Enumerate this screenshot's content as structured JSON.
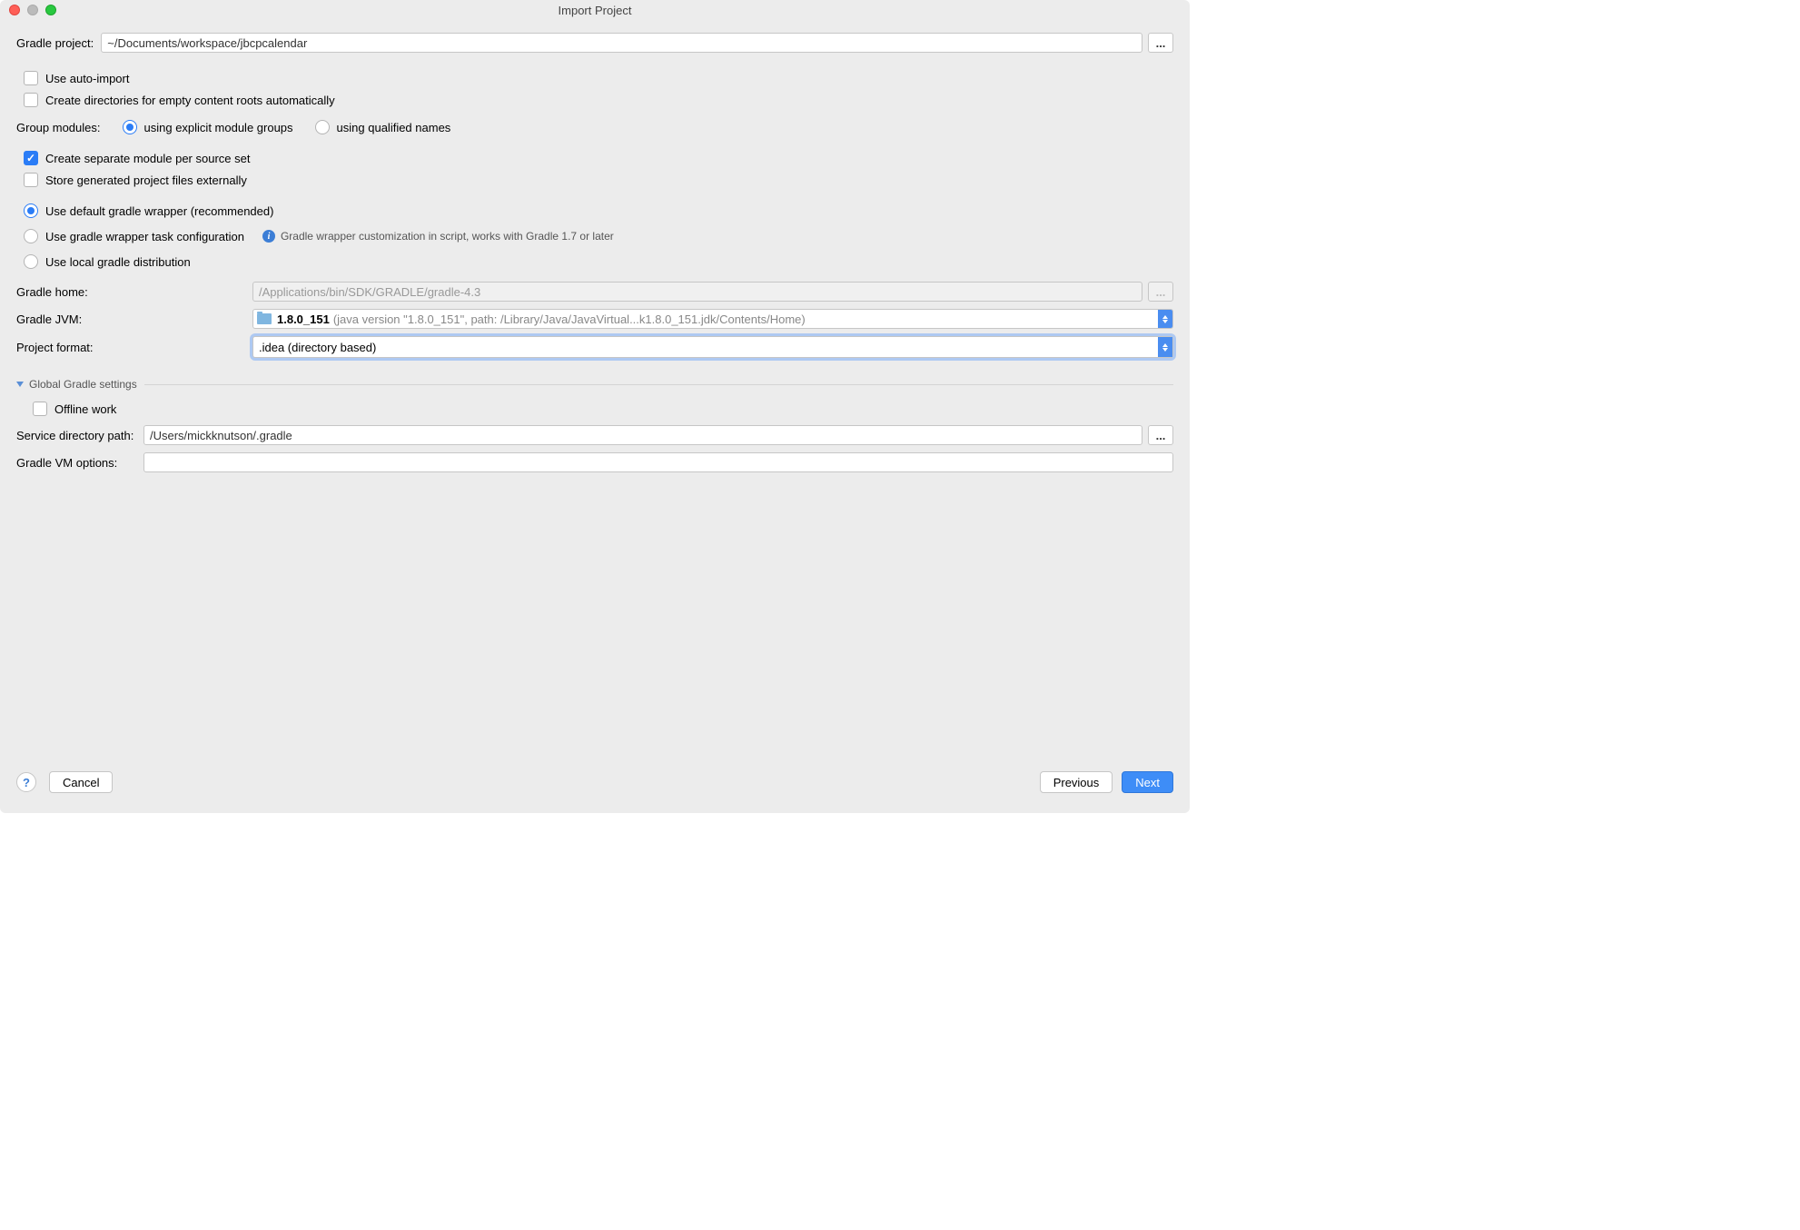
{
  "window": {
    "title": "Import Project"
  },
  "gradle_project": {
    "label": "Gradle project:",
    "path": "~/Documents/workspace/jbcpcalendar"
  },
  "options": {
    "auto_import": {
      "label": "Use auto-import",
      "checked": false
    },
    "create_dirs": {
      "label": "Create directories for empty content roots automatically",
      "checked": false
    },
    "group_modules_label": "Group modules:",
    "group_explicit": {
      "label": "using explicit module groups",
      "selected": true
    },
    "group_qualified": {
      "label": "using qualified names",
      "selected": false
    },
    "separate_module": {
      "label": "Create separate module per source set",
      "checked": true
    },
    "store_external": {
      "label": "Store generated project files externally",
      "checked": false
    }
  },
  "wrapper": {
    "default": {
      "label": "Use default gradle wrapper (recommended)",
      "selected": true
    },
    "task": {
      "label": "Use gradle wrapper task configuration",
      "hint": "Gradle wrapper customization in script, works with Gradle 1.7 or later",
      "selected": false
    },
    "local": {
      "label": "Use local gradle distribution",
      "selected": false
    }
  },
  "gradle_home": {
    "label": "Gradle home:",
    "value": "/Applications/bin/SDK/GRADLE/gradle-4.3"
  },
  "gradle_jvm": {
    "label": "Gradle JVM:",
    "version": "1.8.0_151",
    "detail": "(java version \"1.8.0_151\", path: /Library/Java/JavaVirtual...k1.8.0_151.jdk/Contents/Home)"
  },
  "project_format": {
    "label": "Project format:",
    "value": ".idea (directory based)"
  },
  "global": {
    "header": "Global Gradle settings",
    "offline": {
      "label": "Offline work",
      "checked": false
    },
    "service_dir_label": "Service directory path:",
    "service_dir": "/Users/mickknutson/.gradle",
    "vm_options_label": "Gradle VM options:",
    "vm_options": ""
  },
  "footer": {
    "help": "?",
    "cancel": "Cancel",
    "previous": "Previous",
    "next": "Next"
  },
  "ellipsis": "..."
}
